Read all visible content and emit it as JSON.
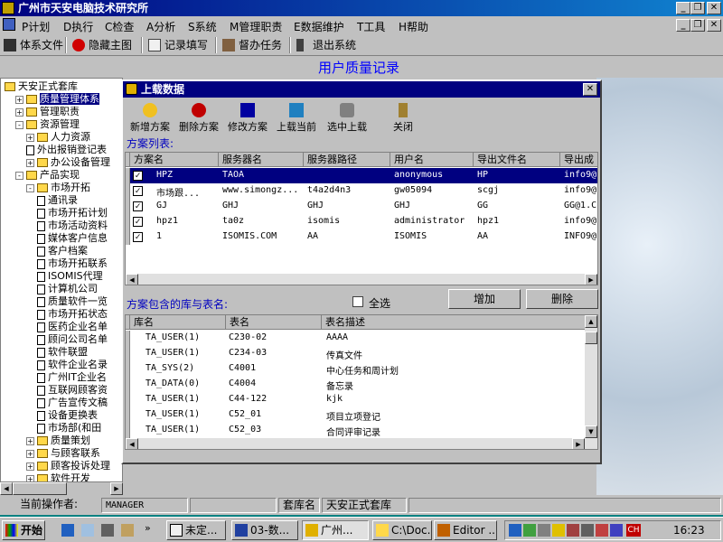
{
  "app": {
    "title": "广州市天安电脑技术研究所"
  },
  "menu": [
    "P计划",
    "D执行",
    "C检查",
    "A分析",
    "S系统",
    "M管理职责",
    "E数据维护",
    "T工具",
    "H帮助"
  ],
  "toolbar": [
    "体系文件",
    "隐藏主图",
    "记录填写",
    "督办任务",
    "退出系统"
  ],
  "banner": {
    "title": "用户质量记录"
  },
  "tree": [
    {
      "label": "天安正式套库",
      "depth": 0,
      "kind": "root"
    },
    {
      "label": "质量管理体系",
      "depth": 1,
      "kind": "folder",
      "box": "+",
      "selected": true
    },
    {
      "label": "管理职责",
      "depth": 1,
      "kind": "folder",
      "box": "+"
    },
    {
      "label": "资源管理",
      "depth": 1,
      "kind": "folder",
      "box": "-"
    },
    {
      "label": "人力资源",
      "depth": 2,
      "kind": "folder",
      "box": "+"
    },
    {
      "label": "外出报销登记表",
      "depth": 2,
      "kind": "doc"
    },
    {
      "label": "办公设备管理",
      "depth": 2,
      "kind": "folder",
      "box": "+"
    },
    {
      "label": "产品实现",
      "depth": 1,
      "kind": "folder",
      "box": "-"
    },
    {
      "label": "市场开拓",
      "depth": 2,
      "kind": "folder",
      "box": "-"
    },
    {
      "label": "通讯录",
      "depth": 3,
      "kind": "doc"
    },
    {
      "label": "市场开拓计划",
      "depth": 3,
      "kind": "doc"
    },
    {
      "label": "市场活动资料",
      "depth": 3,
      "kind": "doc"
    },
    {
      "label": "媒体客户信息",
      "depth": 3,
      "kind": "doc"
    },
    {
      "label": "客户档案",
      "depth": 3,
      "kind": "doc"
    },
    {
      "label": "市场开拓联系",
      "depth": 3,
      "kind": "doc"
    },
    {
      "label": "ISOMIS代理",
      "depth": 3,
      "kind": "doc"
    },
    {
      "label": "计算机公司",
      "depth": 3,
      "kind": "doc"
    },
    {
      "label": "质量软件一览",
      "depth": 3,
      "kind": "doc"
    },
    {
      "label": "市场开拓状态",
      "depth": 3,
      "kind": "doc"
    },
    {
      "label": "医药企业名单",
      "depth": 3,
      "kind": "doc"
    },
    {
      "label": "顾问公司名单",
      "depth": 3,
      "kind": "doc"
    },
    {
      "label": "软件联盟",
      "depth": 3,
      "kind": "doc"
    },
    {
      "label": "软件企业名录",
      "depth": 3,
      "kind": "doc"
    },
    {
      "label": "广州IT企业名",
      "depth": 3,
      "kind": "doc"
    },
    {
      "label": "互联网顾客资",
      "depth": 3,
      "kind": "doc"
    },
    {
      "label": "广告宣传文稿",
      "depth": 3,
      "kind": "doc"
    },
    {
      "label": "设备更换表",
      "depth": 3,
      "kind": "doc"
    },
    {
      "label": "市场部(和田",
      "depth": 3,
      "kind": "doc"
    },
    {
      "label": "质量策划",
      "depth": 2,
      "kind": "folder",
      "box": "+"
    },
    {
      "label": "与顾客联系",
      "depth": 2,
      "kind": "folder",
      "box": "+"
    },
    {
      "label": "顾客投诉处理",
      "depth": 2,
      "kind": "folder",
      "box": "+"
    },
    {
      "label": "软件开发",
      "depth": 2,
      "kind": "folder",
      "box": "+"
    }
  ],
  "dialog": {
    "title": "上载数据",
    "buttons": [
      "新增方案",
      "删除方案",
      "修改方案",
      "上载当前",
      "选中上载",
      "关闭"
    ],
    "plans_label": "方案列表:",
    "plan_columns": [
      "方案名",
      "服务器名",
      "服务器路径",
      "用户名",
      "导出文件名",
      "导出成"
    ],
    "plans": [
      {
        "checked": true,
        "cells": [
          "HPZ",
          "TAOA",
          "",
          "anonymous",
          "HP",
          "info9@"
        ],
        "selected": true
      },
      {
        "checked": true,
        "cells": [
          "市场跟...",
          "www.simongz...",
          "t4a2d4n3",
          "gw05094",
          "scgj",
          "info9@"
        ]
      },
      {
        "checked": true,
        "cells": [
          "GJ",
          "GHJ",
          "GHJ",
          "GHJ",
          "GG",
          "GG@1.C"
        ]
      },
      {
        "checked": true,
        "cells": [
          "hpz1",
          "ta0z",
          "isomis",
          "administrator",
          "hpz1",
          "info9@"
        ]
      },
      {
        "checked": true,
        "cells": [
          "1",
          "ISOMIS.COM",
          "AA",
          "ISOMIS",
          "AA",
          "INFO9@"
        ]
      }
    ],
    "tables_label": "方案包含的库与表名:",
    "select_all": "全选",
    "add_btn": "增加",
    "del_btn": "删除",
    "table_columns": [
      "库名",
      "表名",
      "表名描述"
    ],
    "tables": [
      [
        "TA_USER(1)",
        "C230-02",
        "AAAA"
      ],
      [
        "TA_USER(1)",
        "C234-03",
        "传真文件"
      ],
      [
        "TA_SYS(2)",
        "C4001",
        "中心任务和周计划"
      ],
      [
        "TA_DATA(0)",
        "C4004",
        "备忘录"
      ],
      [
        "TA_USER(1)",
        "C44-122",
        "kjk"
      ],
      [
        "TA_USER(1)",
        "C52_01",
        "项目立项登记"
      ],
      [
        "TA_USER(1)",
        "C52_03",
        "合同评审记录"
      ]
    ]
  },
  "status": {
    "operator_label": "当前操作者:",
    "operator": "MANAGER",
    "lib_label": "套库名",
    "lib": "天安正式套库"
  },
  "taskbar": {
    "start": "开始",
    "tasks": [
      "未定...",
      "03-数...",
      "广州...",
      "C:\\Doc...",
      "Editor ..."
    ],
    "ime": "CH",
    "clock": "16:23"
  }
}
